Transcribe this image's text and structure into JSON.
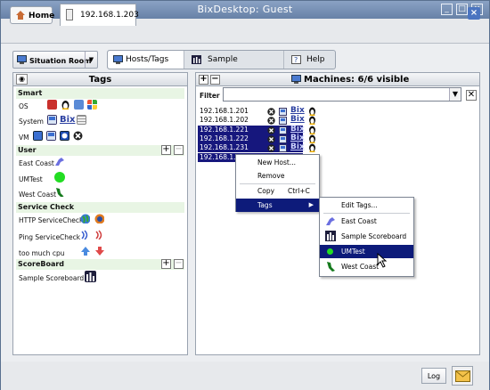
{
  "window": {
    "title": "BixDesktop: Guest",
    "controls": {
      "minimize": "_",
      "maximize": "□",
      "close": "×"
    }
  },
  "top_tabs": {
    "home": "Home",
    "host": "192.168.1.203"
  },
  "toolbar": {
    "situation_room": "Situation Room",
    "tabs": [
      {
        "label": "Hosts/Tags",
        "active": true
      },
      {
        "label": "Sample Scoreboard",
        "active": false
      },
      {
        "label": "Help",
        "active": false
      }
    ]
  },
  "tags_panel": {
    "title": "Tags",
    "sections": {
      "smart": "Smart",
      "user": "User",
      "service_check": "Service Check",
      "scoreboard": "ScoreBoard"
    },
    "rows": {
      "os": "OS",
      "system": "System",
      "bix": "Bix",
      "vm": "VM",
      "east_coast": "East Coast",
      "umtest": "UMTest",
      "west_coast": "West Coast",
      "http_check": "HTTP ServiceCheck",
      "ping_check": "Ping ServiceCheck",
      "cpu": "too much cpu",
      "sample_scoreboard": "Sample Scoreboard"
    }
  },
  "machines_panel": {
    "title": "Machines: 6/6 visible",
    "filter_label": "Filter",
    "filter_value": "",
    "rows": [
      {
        "ip": "192.168.1.201",
        "selected": false
      },
      {
        "ip": "192.168.1.202",
        "selected": false
      },
      {
        "ip": "192.168.1.221",
        "selected": true
      },
      {
        "ip": "192.168.1.222",
        "selected": true
      },
      {
        "ip": "192.168.1.231",
        "selected": true
      },
      {
        "ip": "192.168.1.2",
        "selected": true
      }
    ],
    "bix_label": "Bix"
  },
  "context_menu": {
    "new_host": "New Host...",
    "remove": "Remove",
    "copy": "Copy",
    "copy_shortcut": "Ctrl+C",
    "tags": "Tags"
  },
  "submenu": {
    "edit_tags": "Edit Tags...",
    "east_coast": "East Coast",
    "sample_scoreboard": "Sample Scoreboard",
    "umtest": "UMTest",
    "west_coast": "West Coast"
  },
  "footer": {
    "log": "Log"
  },
  "colors": {
    "selection": "#16177d",
    "section_bg": "#e8f5e4",
    "titlebar": "#7790b5"
  }
}
